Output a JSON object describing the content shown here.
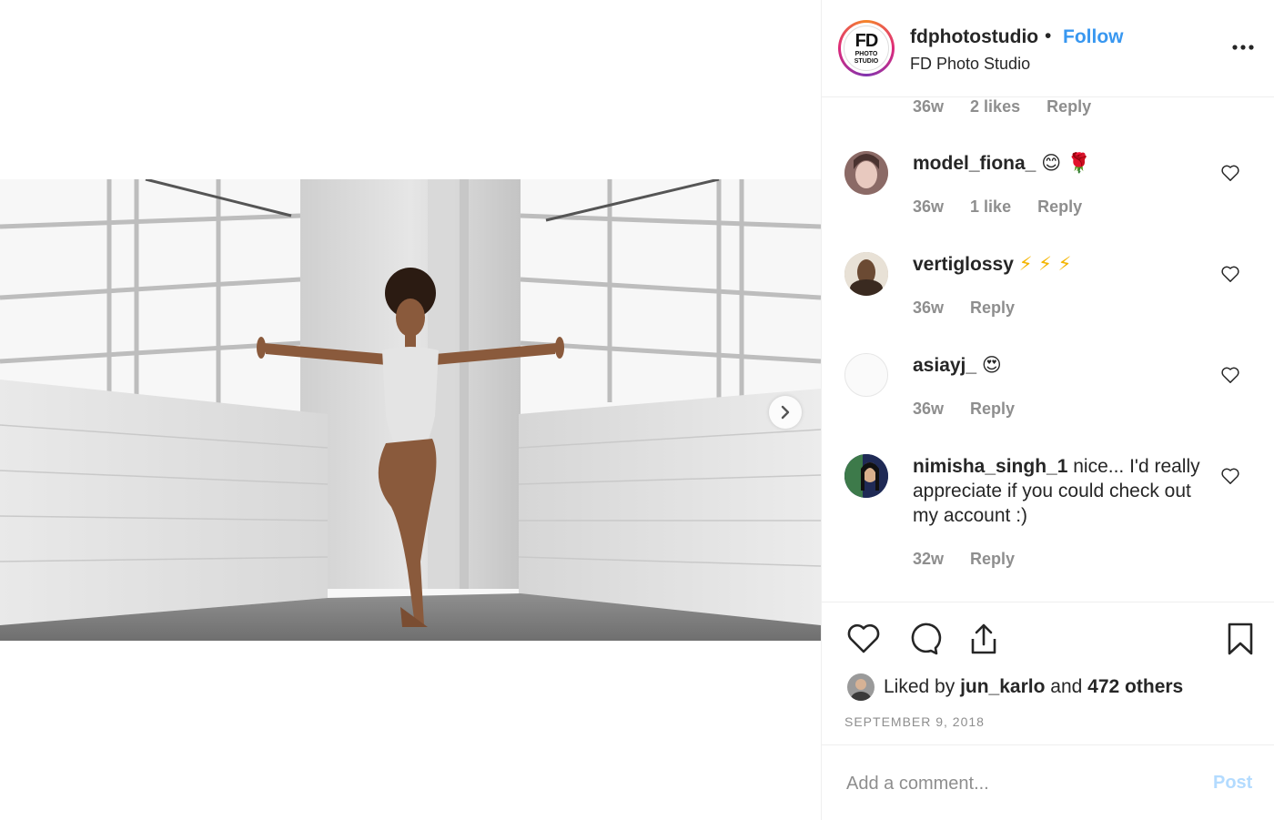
{
  "post": {
    "account": {
      "username": "fdphotostudio",
      "separator": "•",
      "follow_label": "Follow",
      "location": "FD Photo Studio",
      "logo_big": "FD",
      "logo_line1": "PHOTO",
      "logo_line2": "STUDIO"
    },
    "comments_scroll_top_meta": {
      "age": "36w",
      "likes": "2 likes",
      "reply": "Reply"
    },
    "comments": [
      {
        "username": "model_fiona_",
        "text": "😊 🌹",
        "age": "36w",
        "likes": "1 like",
        "reply": "Reply"
      },
      {
        "username": "vertiglossy",
        "text": "⚡ ⚡ ⚡",
        "age": "36w",
        "likes": "",
        "reply": "Reply"
      },
      {
        "username": "asiayj_",
        "text": "😍",
        "age": "36w",
        "likes": "",
        "reply": "Reply"
      },
      {
        "username": "nimisha_singh_1",
        "text": "nice... I'd really appreciate if you could check out my account :)",
        "age": "32w",
        "likes": "",
        "reply": "Reply"
      }
    ],
    "likes": {
      "prefix": "Liked by",
      "first_user": "jun_karlo",
      "connector": "and",
      "others": "472 others"
    },
    "date": "SEPTEMBER 9, 2018",
    "comment_box": {
      "placeholder": "Add a comment...",
      "post_label": "Post"
    },
    "colors": {
      "accent": "#3897f0",
      "post_disabled": "#b3dbff",
      "muted": "#8e8e8e",
      "text": "#262626"
    },
    "icons": [
      "more-icon",
      "heart-icon",
      "comment-icon",
      "share-icon",
      "bookmark-icon",
      "chevron-right-icon"
    ]
  }
}
